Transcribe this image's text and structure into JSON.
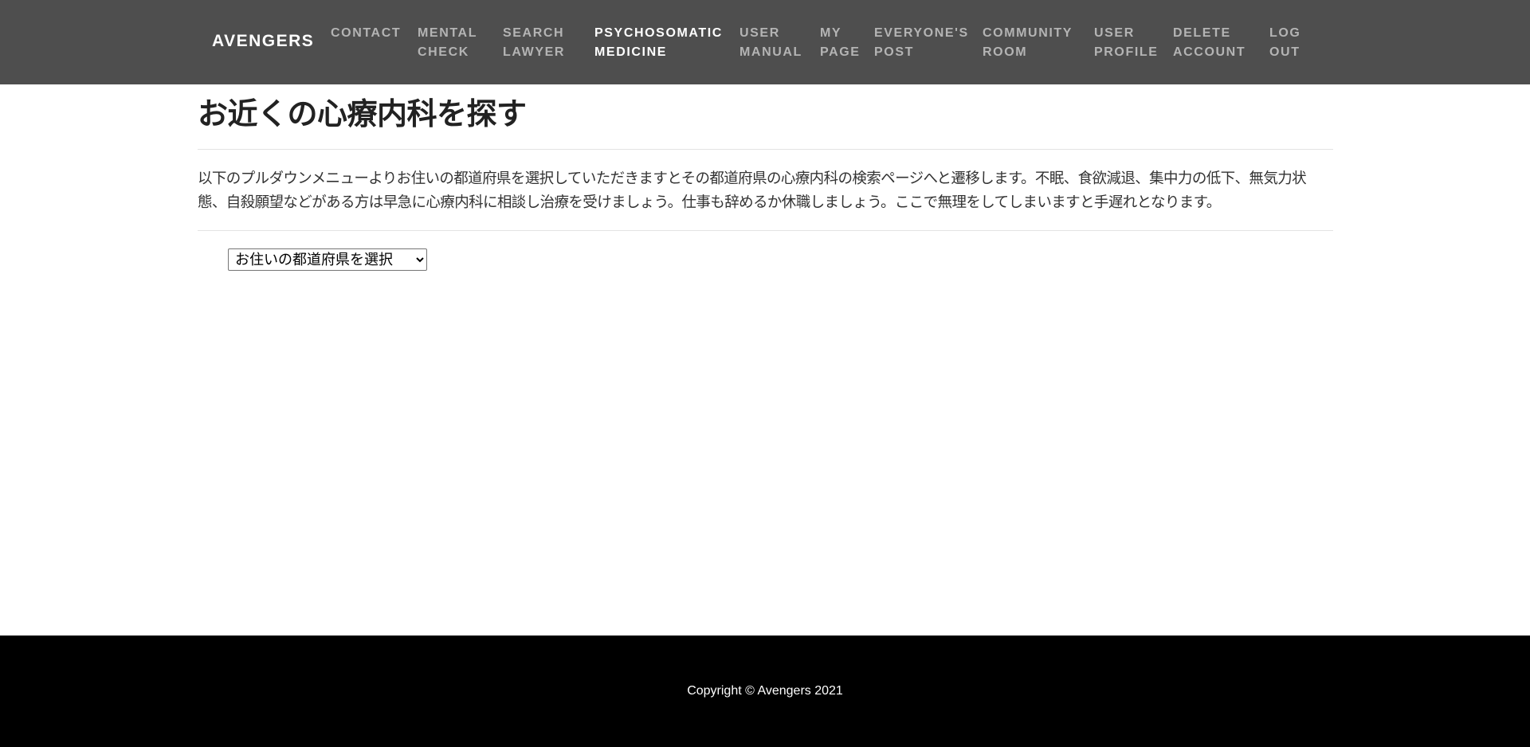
{
  "navbar": {
    "brand": "AVENGERS",
    "items": [
      {
        "label": "CONTACT",
        "active": false
      },
      {
        "label": "MENTAL\nCHECK",
        "active": false
      },
      {
        "label": "SEARCH\nLAWYER",
        "active": false
      },
      {
        "label": "PSYCHOSOMATIC\nMEDICINE",
        "active": true
      },
      {
        "label": "USER\nMANUAL",
        "active": false
      },
      {
        "label": "MY\nPAGE",
        "active": false
      },
      {
        "label": "EVERYONE'S\nPOST",
        "active": false
      },
      {
        "label": "COMMUNITY\nROOM",
        "active": false
      },
      {
        "label": "USER\nPROFILE",
        "active": false
      },
      {
        "label": "DELETE\nACCOUNT",
        "active": false
      },
      {
        "label": "LOG\nOUT",
        "active": false
      }
    ]
  },
  "main": {
    "title": "お近くの心療内科を探す",
    "intro": "以下のプルダウンメニューよりお住いの都道府県を選択していただきますとその都道府県の心療内科の検索ページへと遷移します。不眠、食欲減退、集中力の低下、無気力状態、自殺願望などがある方は早急に心療内科に相談し治療を受けましょう。仕事も辞めるか休職しましょう。ここで無理をしてしまいますと手遅れとなります。",
    "prefecture_select": {
      "selected": "お住いの都道府県を選択"
    }
  },
  "footer": {
    "copyright": "Copyright © Avengers 2021"
  },
  "colors": {
    "navbar_bg": "#4e4e4e",
    "nav_text": "#b4b4b4",
    "nav_active": "#ffffff",
    "footer_bg": "#000000"
  }
}
